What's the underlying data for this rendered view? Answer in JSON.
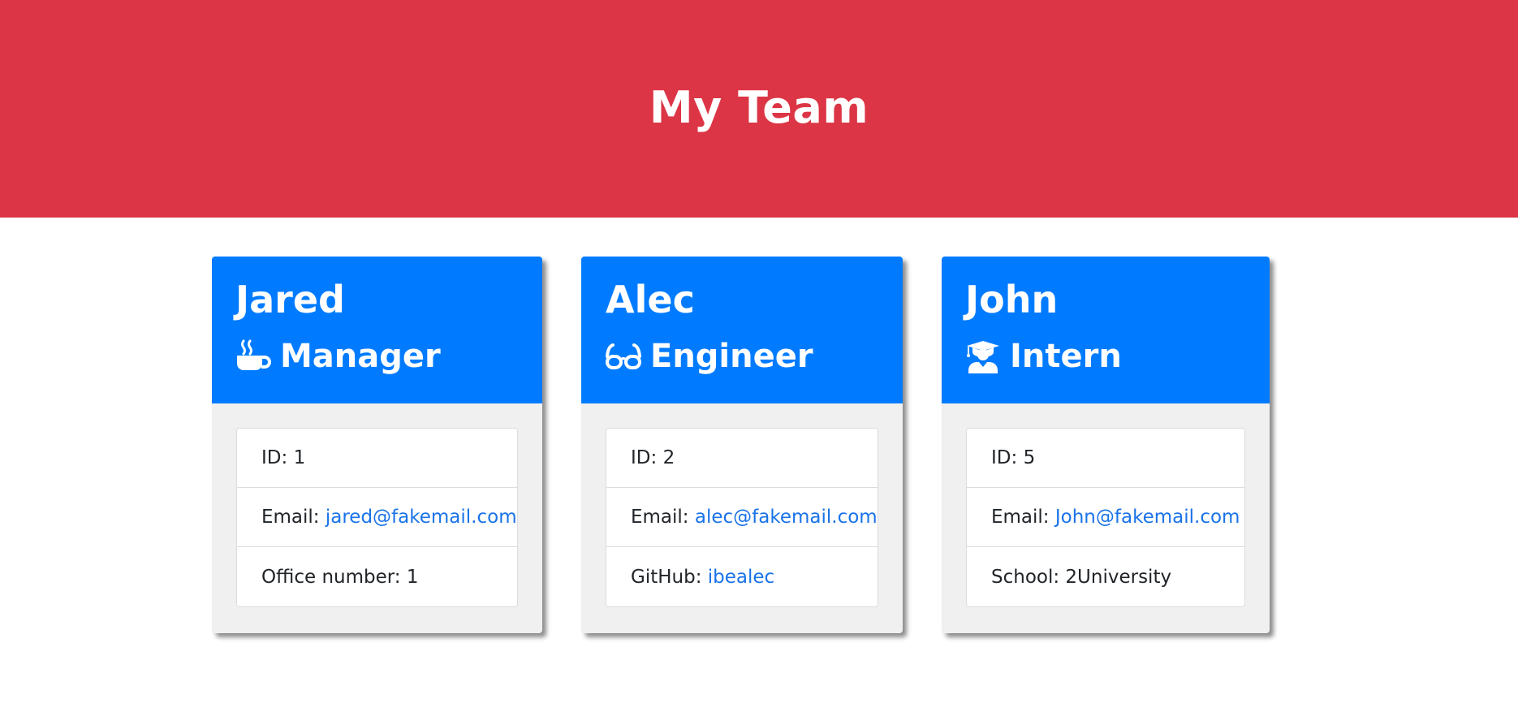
{
  "page": {
    "title": "My Team"
  },
  "colors": {
    "header_bg": "#dc3545",
    "card_header_bg": "#007bff",
    "link": "#1a73e8"
  },
  "team": [
    {
      "name": "Jared",
      "role": "Manager",
      "role_icon": "coffee-mug-icon",
      "id_label": "ID: ",
      "id": "1",
      "email_label": "Email: ",
      "email": "jared@fakemail.com",
      "extra_label": "Office number: ",
      "extra_value": "1"
    },
    {
      "name": "Alec",
      "role": "Engineer",
      "role_icon": "glasses-icon",
      "id_label": "ID: ",
      "id": "2",
      "email_label": "Email: ",
      "email": "alec@fakemail.com",
      "extra_label": "GitHub: ",
      "extra_value": "ibealec"
    },
    {
      "name": "John",
      "role": "Intern",
      "role_icon": "graduate-icon",
      "id_label": "ID: ",
      "id": "5",
      "email_label": "Email: ",
      "email": "John@fakemail.com",
      "extra_label": "School: ",
      "extra_value": "2University"
    }
  ]
}
